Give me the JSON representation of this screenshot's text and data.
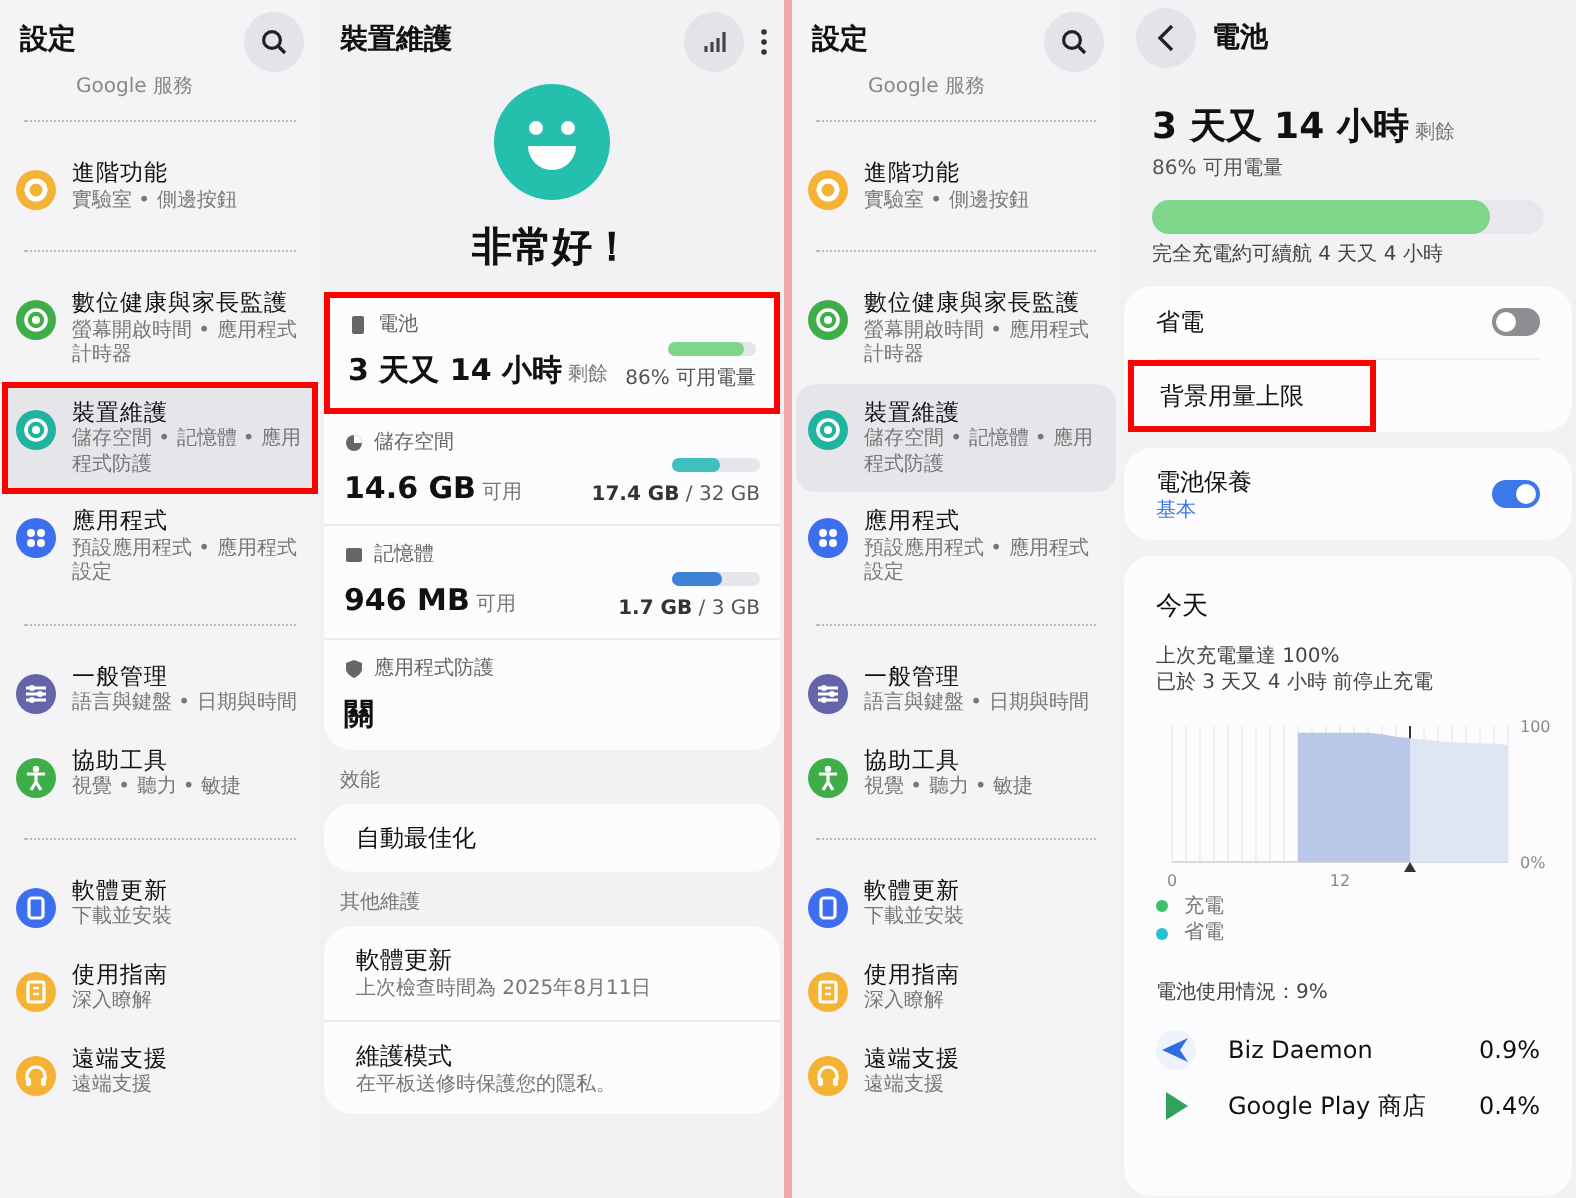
{
  "settings_left": {
    "title": "設定",
    "top_partial": "Google 服務",
    "groups": [
      {
        "items": [
          {
            "title": "進階功能",
            "subtitle": "實驗室 • 側邊按鈕",
            "color": "#f5b335",
            "selected": false,
            "highlighted": false
          }
        ]
      },
      {
        "items": [
          {
            "title": "數位健康與家長監護",
            "subtitle": "螢幕開啟時間 • 應用程式計時器",
            "color": "#3fae49",
            "selected": false,
            "highlighted": false
          },
          {
            "title": "裝置維護",
            "subtitle": "儲存空間 • 記憶體 • 應用程式防護",
            "color": "#1fb3a0",
            "selected": true,
            "highlighted": true
          },
          {
            "title": "應用程式",
            "subtitle": "預設應用程式 • 應用程式設定",
            "color": "#3d6ef0",
            "selected": false,
            "highlighted": false
          }
        ]
      },
      {
        "items": [
          {
            "title": "一般管理",
            "subtitle": "語言與鍵盤 • 日期與時間",
            "color": "#6464a8",
            "selected": false,
            "highlighted": false
          },
          {
            "title": "協助工具",
            "subtitle": "視覺 • 聽力 • 敏捷",
            "color": "#3fae49",
            "selected": false,
            "highlighted": false
          }
        ]
      },
      {
        "items": [
          {
            "title": "軟體更新",
            "subtitle": "下載並安裝",
            "color": "#3d6ef0",
            "selected": false,
            "highlighted": false
          },
          {
            "title": "使用指南",
            "subtitle": "深入瞭解",
            "color": "#f5b335",
            "selected": false,
            "highlighted": false
          },
          {
            "title": "遠端支援",
            "subtitle": "遠端支援",
            "color": "#f5b335",
            "selected": false,
            "highlighted": false
          }
        ]
      }
    ]
  },
  "device_care": {
    "title": "裝置維護",
    "status": "非常好！",
    "cards": [
      {
        "label": "電池",
        "value": "3 天又 14 小時",
        "unit": "剩餘",
        "level": 0.86,
        "reading": "86% 可用電量",
        "color": "#7fd68a",
        "highlighted": true
      },
      {
        "label": "儲存空間",
        "value": "14.6 GB",
        "unit": "可用",
        "level": 0.54,
        "reading": "**17.4 GB** / 32 GB",
        "color": "#3fbfbf",
        "highlighted": false
      },
      {
        "label": "記憶體",
        "value": "946 MB",
        "unit": "可用",
        "level": 0.57,
        "reading": "**1.7 GB** / 3 GB",
        "color": "#3d82d6",
        "highlighted": false
      },
      {
        "label": "應用程式防護",
        "value": "關",
        "highlighted": false
      }
    ],
    "sections": [
      {
        "heading": "效能",
        "items": [
          {
            "title": "自動最佳化"
          }
        ]
      },
      {
        "heading": "其他維護",
        "items": [
          {
            "title": "軟體更新",
            "subtitle": "上次檢查時間為 2025年8月11日"
          },
          {
            "title": "維護模式",
            "subtitle": "在平板送修時保護您的隱私。"
          }
        ]
      }
    ]
  },
  "settings_right": {
    "title": "設定",
    "top_partial": "Google 服務",
    "groups": [
      {
        "items": [
          {
            "title": "進階功能",
            "subtitle": "實驗室 • 側邊按鈕",
            "color": "#f5b335",
            "selected": false,
            "highlighted": false
          }
        ]
      },
      {
        "items": [
          {
            "title": "數位健康與家長監護",
            "subtitle": "螢幕開啟時間 • 應用程式計時器",
            "color": "#3fae49",
            "selected": false,
            "highlighted": false
          },
          {
            "title": "裝置維護",
            "subtitle": "儲存空間 • 記憶體 • 應用程式防護",
            "color": "#1fb3a0",
            "selected": true,
            "highlighted": false
          },
          {
            "title": "應用程式",
            "subtitle": "預設應用程式 • 應用程式設定",
            "color": "#3d6ef0",
            "selected": false,
            "highlighted": false
          }
        ]
      },
      {
        "items": [
          {
            "title": "一般管理",
            "subtitle": "語言與鍵盤 • 日期與時間",
            "color": "#6464a8",
            "selected": false,
            "highlighted": false
          },
          {
            "title": "協助工具",
            "subtitle": "視覺 • 聽力 • 敏捷",
            "color": "#3fae49",
            "selected": false,
            "highlighted": false
          }
        ]
      },
      {
        "items": [
          {
            "title": "軟體更新",
            "subtitle": "下載並安裝",
            "color": "#3d6ef0",
            "selected": false,
            "highlighted": false
          },
          {
            "title": "使用指南",
            "subtitle": "深入瞭解",
            "color": "#f5b335",
            "selected": false,
            "highlighted": false
          },
          {
            "title": "遠端支援",
            "subtitle": "遠端支援",
            "color": "#f5b335",
            "selected": false,
            "highlighted": false
          }
        ]
      }
    ]
  },
  "battery": {
    "title": "電池",
    "remaining": "3 天又 14 小時",
    "remaining_unit": "剩餘",
    "percent_text": "86% 可用電量",
    "level": 0.86,
    "full_charge": "完全充電約可續航 4 天又 4 小時",
    "rows": [
      {
        "kind": "toggle",
        "title": "省電",
        "on": false,
        "highlighted": false
      },
      {
        "kind": "plain",
        "title": "背景用量上限",
        "highlighted": true
      }
    ],
    "care": {
      "title": "電池保養",
      "subtitle": "基本",
      "on": true
    },
    "today": {
      "title": "今天",
      "lines": [
        "上次充電量達 100%",
        "已於 3 天又 4 小時 前停止充電"
      ],
      "chart_data": {
        "type": "area",
        "x": [
          9,
          10,
          11,
          12,
          13,
          14,
          15,
          16,
          17,
          18,
          19,
          20,
          21,
          22,
          23,
          24
        ],
        "series": [
          {
            "color": "#b9c8e8",
            "values": [
              95,
              95,
              95,
              95,
              95,
              95,
              94,
              92,
              91,
              null,
              null,
              null,
              null,
              null,
              null,
              null
            ]
          },
          {
            "color": "#dfe6f3",
            "values": [
              null,
              null,
              null,
              null,
              null,
              null,
              null,
              null,
              91,
              90,
              89,
              88,
              88,
              87,
              87,
              86
            ]
          }
        ],
        "xlim": [
          0,
          24
        ],
        "ylim": [
          0,
          100
        ],
        "xticks": [
          0,
          12
        ],
        "yticks": [
          {
            "value": 100,
            "label": "100"
          },
          {
            "value": 0,
            "label": "0%"
          }
        ],
        "ref_lines": [
          {
            "axis": "x",
            "value": 17
          }
        ]
      },
      "legend": [
        {
          "label": "充電",
          "color": "#3dbf6a"
        },
        {
          "label": "省電",
          "color": "#22c1d6"
        }
      ],
      "usage": "電池使用情況：9%",
      "apps": [
        {
          "name": "Biz Daemon",
          "percent": "0.9%"
        },
        {
          "name": "Google Play 商店",
          "percent": "0.4%"
        }
      ]
    }
  }
}
